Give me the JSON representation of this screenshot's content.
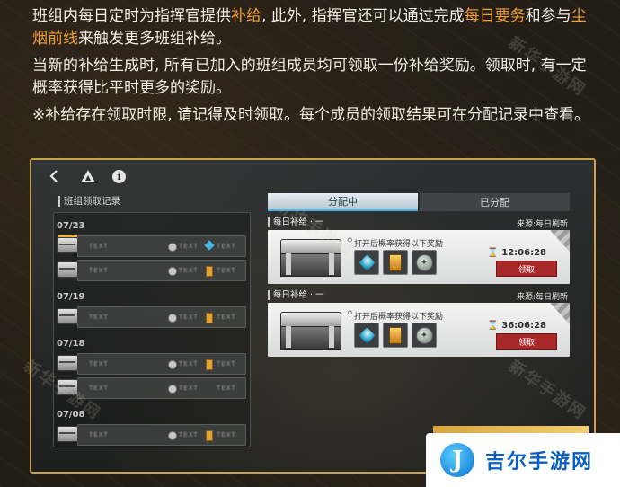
{
  "intro": {
    "p1_a": "班组内每日定时为指挥官提供",
    "p1_hl1": "补给",
    "p1_b": ", 此外, 指挥官还可以通过完成",
    "p1_hl2": "每日要务",
    "p1_c": "和参与",
    "p1_hl3": "尘烟前线",
    "p1_d": "来触发更多班组补给。",
    "p2": "当新的补给生成时, 所有已加入的班组成员均可领取一份补给奖励。领取时, 有一定概率获得比平时更多的奖励。",
    "p3": "※补给存在领取时限, 请记得及时领取。每个成员的领取结果可在分配记录中查看。"
  },
  "topbar": {
    "back_icon": "chevron-left-icon",
    "squad_icon": "triangle-logo-icon",
    "info_icon": "info-icon",
    "info_glyph": "i"
  },
  "left_panel": {
    "title": "班组领取记录",
    "groups": [
      {
        "date": "07/23",
        "rows": [
          {
            "chest": "gold",
            "text": "TEXT",
            "r1": "TEXT",
            "r2": "TEXT",
            "r2_type": "blue"
          },
          {
            "chest": "silver",
            "text": "TEXT",
            "r1": "TEXT",
            "r2": "TEXT",
            "r2_type": "gold"
          }
        ]
      },
      {
        "date": "07/19",
        "rows": [
          {
            "chest": "silver",
            "text": "TEXT",
            "r1": "TEXT",
            "r2": "TEXT",
            "r2_type": "gold"
          }
        ]
      },
      {
        "date": "07/18",
        "rows": [
          {
            "chest": "silver",
            "text": "TEXT",
            "r1": "TEXT",
            "r2": "TEXT",
            "r2_type": "gold"
          },
          {
            "chest": "silver",
            "text": "TEXT",
            "r1": "TEXT",
            "r2": "TEXT",
            "r2_type": "none"
          }
        ]
      },
      {
        "date": "07/08",
        "rows": [
          {
            "chest": "silver",
            "text": "TEXT",
            "r1": "TEXT",
            "r2": "TEXT",
            "r2_type": "gold"
          }
        ]
      }
    ]
  },
  "tabs": [
    {
      "label": "分配中",
      "active": true
    },
    {
      "label": "已分配",
      "active": false
    }
  ],
  "cards": [
    {
      "name": "每日补给 · 一",
      "source": "来源:每日刷新",
      "desc": "打开后概率获得以下奖励",
      "timer": "⌛ 12:06:28",
      "claim_label": "领取"
    },
    {
      "name": "每日补给 · 一",
      "source": "来源:每日刷新",
      "desc": "打开后概率获得以下奖励",
      "timer": "⌛ 36:06:28",
      "claim_label": "领取"
    }
  ],
  "watermarks": [
    "新华手游网",
    "新华手游网",
    "新华手游网",
    "新华手游网"
  ],
  "site_logo": {
    "letter": "J",
    "text": "吉尔手游网"
  },
  "colors": {
    "highlight": "#f0a035",
    "window_border": "#c9a14a",
    "claim_button": "#a8282a",
    "active_tab_accent": "#4bb3e6"
  }
}
